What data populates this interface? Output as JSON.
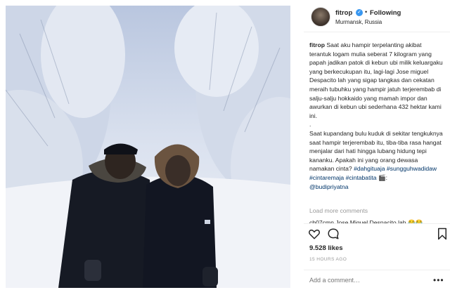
{
  "header": {
    "username": "fitrop",
    "separator": "•",
    "following_label": "Following",
    "location": "Murmansk, Russia",
    "verified_icon": "verified-badge-icon"
  },
  "caption": {
    "username": "fitrop",
    "paragraph1": "Saat aku hampir terpelanting akibat terantuk logam mulia seberat 7 kilogram yang papah jadikan patok di kebun ubi milik keluargaku yang berkecukupan itu, lagi-lagi Jose miguel Despacito lah yang sigap tangkas dan cekatan meraih tubuhku yang hampir jatuh terjerembab di salju-salju hokkaido yang mamah impor dan awurkan di kebun ubi sederhana 432 hektar kami ini.",
    "paragraph2_line": ".",
    "paragraph3": "Saat kupandang bulu kuduk di sekitar tengkuknya saat hampir terjerembab itu, tiba-tiba rasa hangat menjalar dari hati hingga lubang hidung tepi kananku. Apakah ini yang orang dewasa namakan cinta? ",
    "tag1": "#dahgituaja",
    "tag2": "#sungguhwadidaw",
    "tag3": "#cintaremaja",
    "tag4": "#cintabatita",
    "emoji": "🎬:",
    "mention": "@budipriyatna"
  },
  "comments": {
    "load_more": "Load more comments",
    "peek": "cb07cmn Jose Miguel Despacito lah 😂😂"
  },
  "actions": {
    "like_icon": "heart-icon",
    "comment_icon": "comment-icon",
    "save_icon": "bookmark-icon"
  },
  "stats": {
    "likes": "9.528 likes",
    "time": "15 HOURS AGO"
  },
  "add_comment": {
    "placeholder": "Add a comment…",
    "more": "•••"
  },
  "colors": {
    "accent": "#3897f0",
    "hashtag": "#003569",
    "muted": "#999999"
  }
}
